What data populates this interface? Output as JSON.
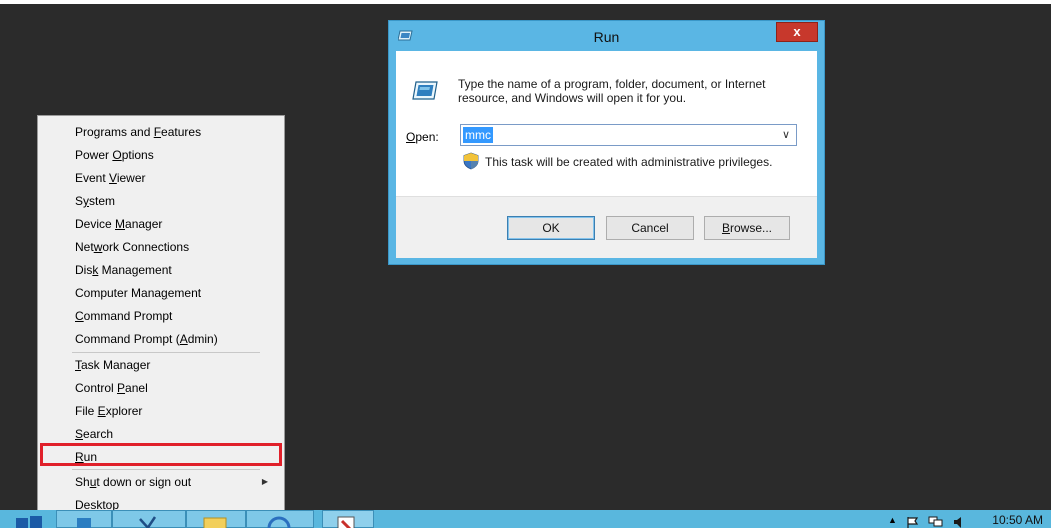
{
  "run_dialog": {
    "title": "Run",
    "close_label": "x",
    "description": "Type the name of a program, folder, document, or Internet resource, and Windows will open it for you.",
    "open_label_underlined": "O",
    "open_label_rest": "pen:",
    "open_value": "mmc",
    "admin_note": "This task will be created with administrative privileges.",
    "ok_label": "OK",
    "cancel_label": "Cancel",
    "browse_label_underlined": "B",
    "browse_label_rest": "rowse..."
  },
  "winx_menu": {
    "items": [
      {
        "pre": "Programs and ",
        "u": "F",
        "post": "eatures"
      },
      {
        "pre": "Power ",
        "u": "O",
        "post": "ptions"
      },
      {
        "pre": "Event ",
        "u": "V",
        "post": "iewer"
      },
      {
        "pre": "S",
        "u": "y",
        "post": "stem"
      },
      {
        "pre": "Device ",
        "u": "M",
        "post": "anager"
      },
      {
        "pre": "Net",
        "u": "w",
        "post": "ork Connections"
      },
      {
        "pre": "Dis",
        "u": "k",
        "post": " Management"
      },
      {
        "pre": "Computer Mana",
        "u": "g",
        "post": "ement"
      },
      {
        "pre": "",
        "u": "C",
        "post": "ommand Prompt"
      },
      {
        "pre": "Command Prompt (",
        "u": "A",
        "post": "dmin)"
      },
      {
        "pre": "",
        "u": "T",
        "post": "ask Manager"
      },
      {
        "pre": "Control ",
        "u": "P",
        "post": "anel"
      },
      {
        "pre": "File ",
        "u": "E",
        "post": "xplorer"
      },
      {
        "pre": "",
        "u": "S",
        "post": "earch"
      },
      {
        "pre": "",
        "u": "R",
        "post": "un"
      },
      {
        "pre": "Sh",
        "u": "u",
        "post": "t down or sign out"
      },
      {
        "pre": "",
        "u": "D",
        "post": "esktop"
      }
    ]
  },
  "taskbar": {
    "clock": "10:50 AM"
  },
  "colors": {
    "dialog_frame": "#5ab6e4",
    "taskbar": "#59b7dd",
    "highlight": "#e0202a",
    "selection": "#3399ff"
  }
}
